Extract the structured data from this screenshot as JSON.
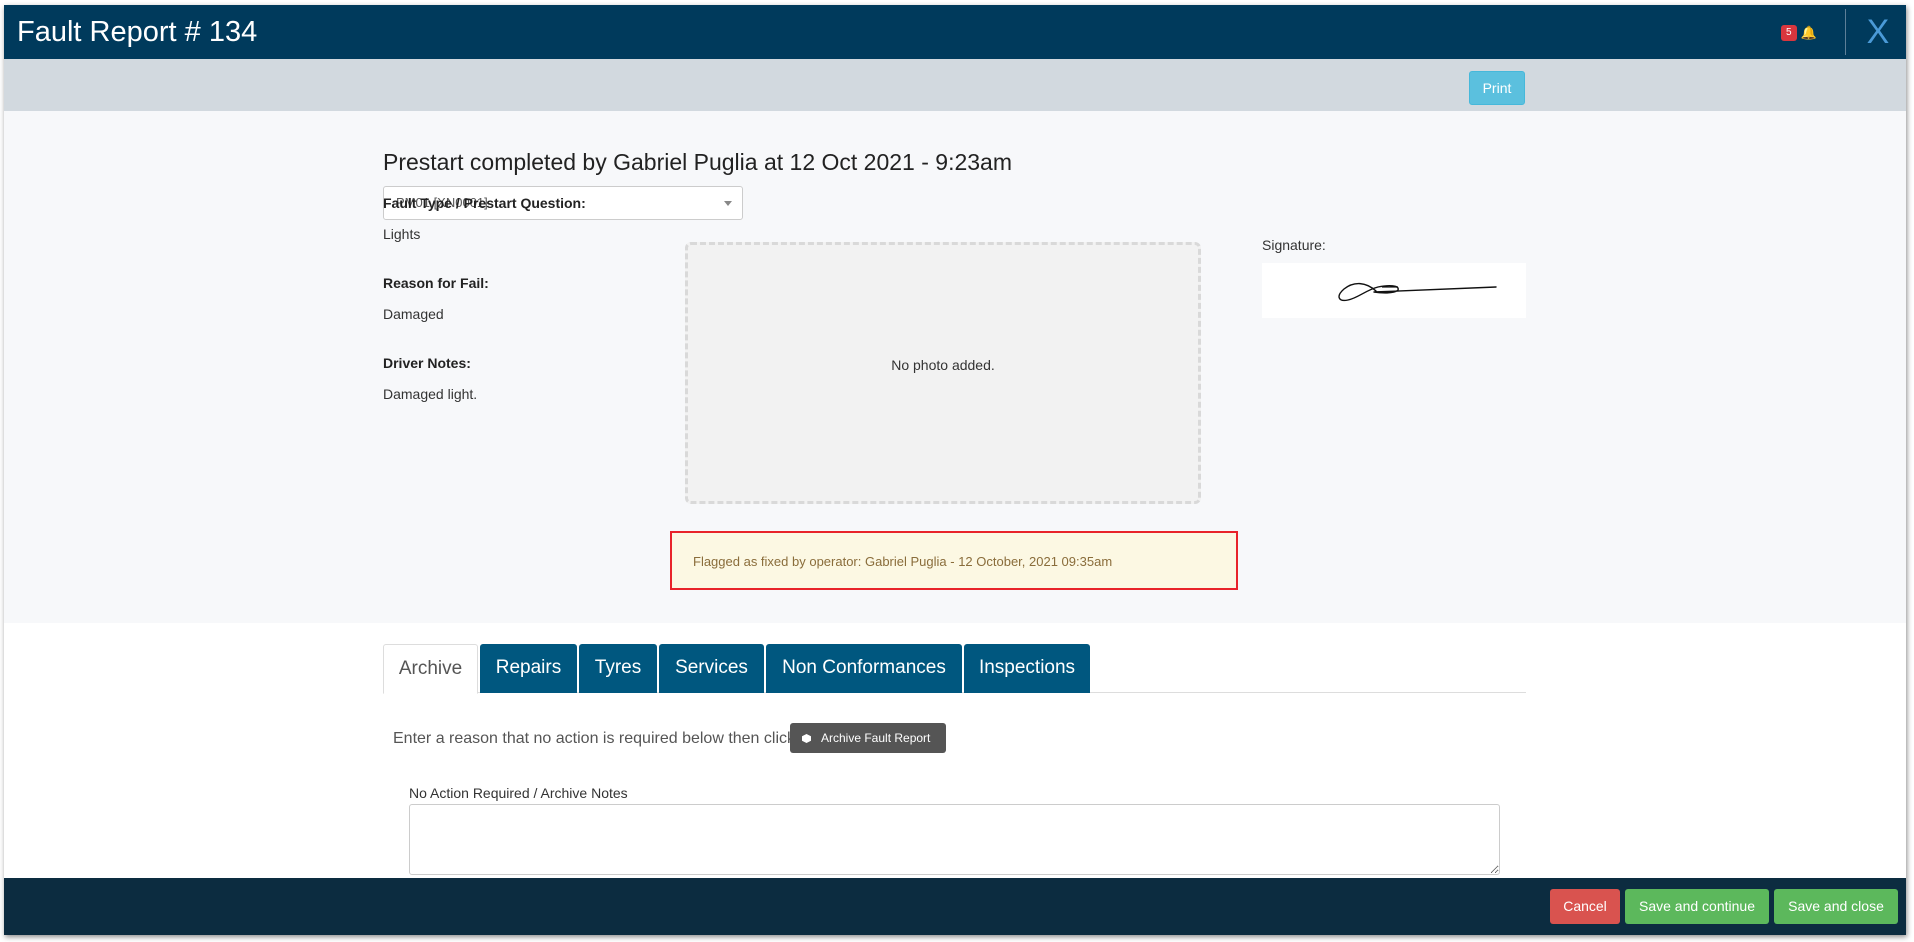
{
  "header": {
    "title": "Fault Report # 134",
    "notification_count": "5",
    "bell_icon": "bell-icon",
    "close_label": "X"
  },
  "toolbar": {
    "print_label": "Print"
  },
  "report": {
    "heading": "Prestart completed by Gabriel Puglia at 12 Oct 2021 - 9:23am",
    "asset_select": "PM01 [XN0001]",
    "fault_type_label": "Fault Type / Prestart Question:",
    "fault_type_value": "Lights",
    "reason_label": "Reason for Fail:",
    "reason_value": "Damaged",
    "driver_notes_label": "Driver Notes:",
    "driver_notes_value": "Damaged light.",
    "photo_placeholder": "No photo added.",
    "signature_label": "Signature:",
    "flag_message": "Flagged as fixed by operator: Gabriel Puglia - 12 October, 2021 09:35am"
  },
  "tabs": [
    {
      "label": "Archive",
      "active": true
    },
    {
      "label": "Repairs",
      "active": false
    },
    {
      "label": "Tyres",
      "active": false
    },
    {
      "label": "Services",
      "active": false
    },
    {
      "label": "Non Conformances",
      "active": false
    },
    {
      "label": "Inspections",
      "active": false
    }
  ],
  "archive": {
    "instruction": "Enter a reason that no action is required below then click",
    "button_label": "Archive Fault Report",
    "notes_label": "No Action Required / Archive Notes",
    "notes_value": ""
  },
  "footer": {
    "cancel_label": "Cancel",
    "save_continue_label": "Save and continue",
    "save_close_label": "Save and close"
  },
  "colors": {
    "header_bg": "#003a5c",
    "tab_bg": "#00577f",
    "footer_bg": "#0c2c40",
    "print_btn": "#5bc0de",
    "cancel_btn": "#d9534f",
    "save_btn": "#5cb85c",
    "alert_border": "#e8232a"
  }
}
